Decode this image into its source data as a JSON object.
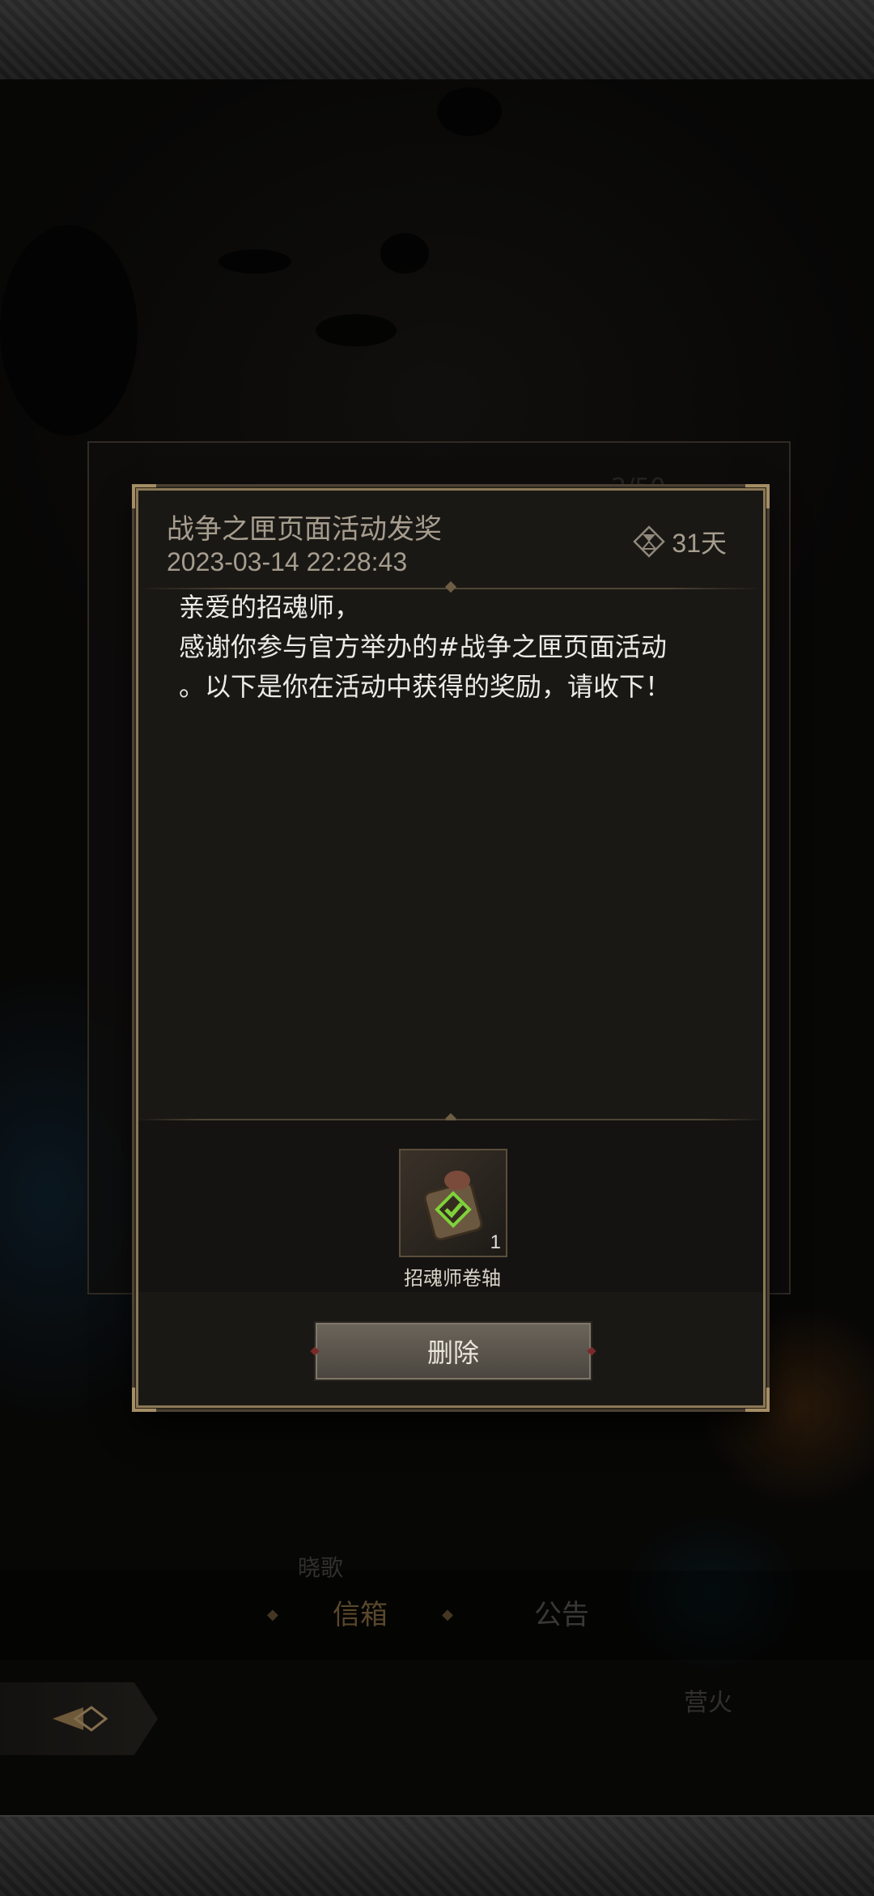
{
  "mail": {
    "subject": "战争之匣页面活动发奖",
    "date": "2023-03-14 22:28:43",
    "expiry": "31天",
    "body": "亲爱的招魂师，\n感谢你参与官方举办的#战争之匣页面活动\n。以下是你在活动中获得的奖励，请收下！"
  },
  "attachment": {
    "item_name": "招魂师卷轴",
    "item_count": "1"
  },
  "actions": {
    "delete_label": "删除"
  },
  "background": {
    "counter": "2/50",
    "tabs": [
      "信箱",
      "公告"
    ],
    "tab_above": "晓歌",
    "campfire": "营火"
  },
  "colors": {
    "accent_gold": "#8a7756",
    "claimed_check": "#7fd23a"
  },
  "icons": {
    "expiry": "hourglass-icon",
    "claimed": "check-diamond-icon",
    "back": "back-arrow-icon"
  }
}
